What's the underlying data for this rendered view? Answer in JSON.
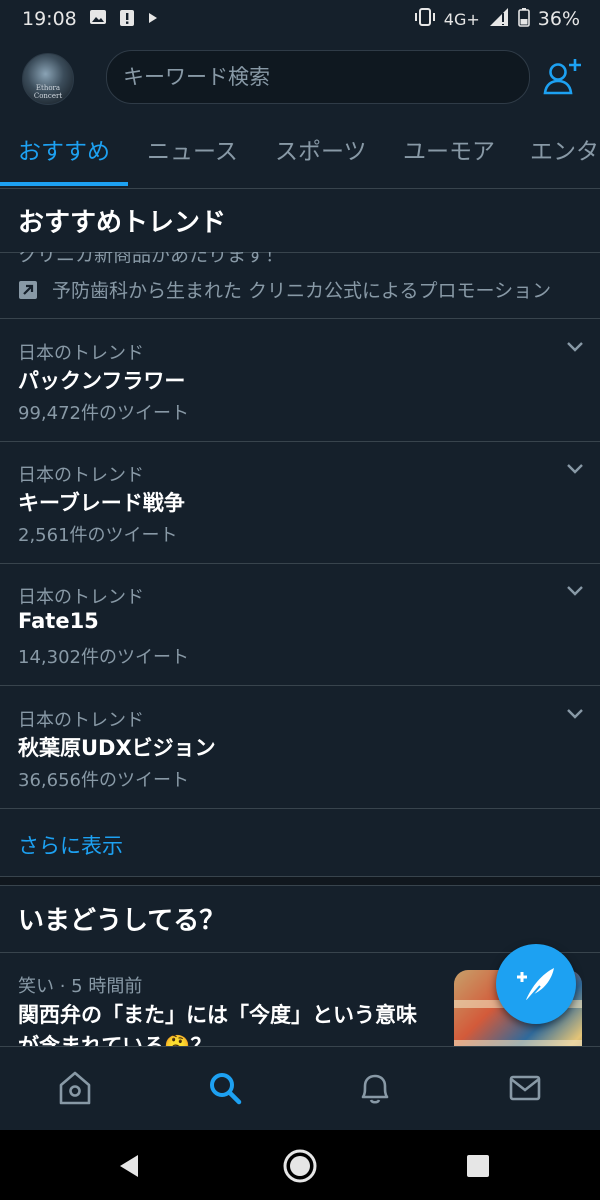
{
  "status_bar": {
    "time": "19:08",
    "network": "4G+",
    "battery": "36%",
    "icons": [
      "image-icon",
      "alert-icon",
      "play-icon",
      "vibrate-icon",
      "signal-icon",
      "battery-icon"
    ]
  },
  "header": {
    "avatar_caption": "Ethora Concert",
    "search_placeholder": "キーワード検索",
    "add_user_icon": "add-user-icon"
  },
  "tabs": [
    {
      "label": "おすすめ",
      "active": true
    },
    {
      "label": "ニュース",
      "active": false
    },
    {
      "label": "スポーツ",
      "active": false
    },
    {
      "label": "ユーモア",
      "active": false
    },
    {
      "label": "エンタ",
      "active": false
    }
  ],
  "section_title": "おすすめトレンド",
  "promo": {
    "cut_text": "クリニカ新商品があたります！",
    "label": "予防歯科から生まれた クリニカ公式によるプロモーション"
  },
  "trends": [
    {
      "context": "日本のトレンド",
      "name": "パックンフラワー",
      "count": "99,472件のツイート"
    },
    {
      "context": "日本のトレンド",
      "name": "キーブレード戦争",
      "count": "2,561件のツイート"
    },
    {
      "context": "日本のトレンド",
      "name": "Fate15",
      "count": "14,302件のツイート"
    },
    {
      "context": "日本のトレンド",
      "name": "秋葉原UDXビジョン",
      "count": "36,656件のツイート"
    }
  ],
  "show_more": "さらに表示",
  "section2_title": "いまどうしてる？",
  "news": {
    "meta": "笑い · 5 時間前",
    "headline": "関西弁の「また」には「今度」という意味が含まれている🤔？"
  },
  "colors": {
    "background": "#15202b",
    "accent": "#1da1f2",
    "secondary_text": "#8899a6",
    "divider": "#38444d"
  }
}
